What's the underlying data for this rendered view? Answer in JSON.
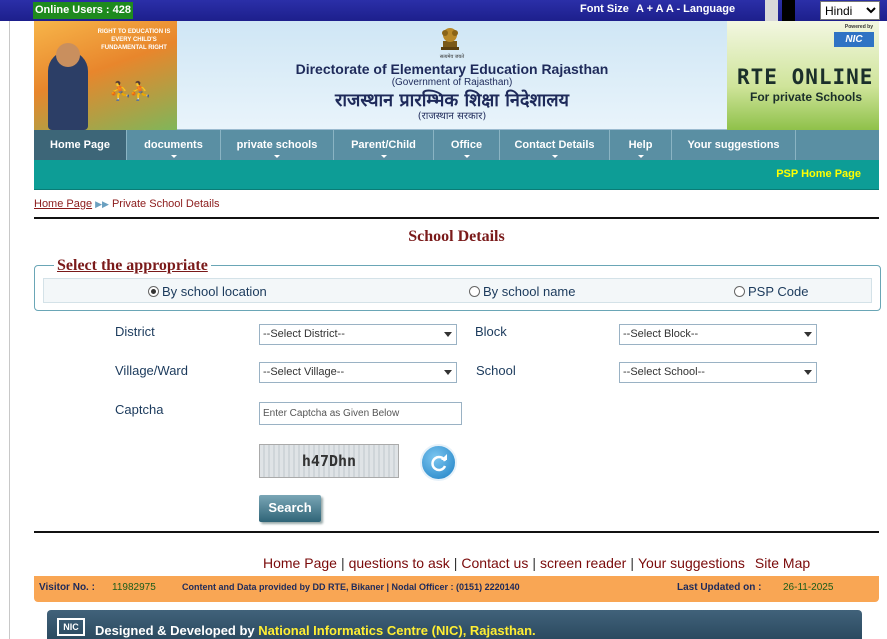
{
  "topbar": {
    "online_users": "Online Users : 428",
    "font_size_label": "Font Size",
    "font_controls": "A + A A - Language",
    "language_selected": "Hindi"
  },
  "banner": {
    "emblem_caption": "सत्यमेव जयते",
    "slogan": "RIGHT TO EDUCATION IS EVERY CHILD'S FUNDAMENTAL RIGHT",
    "title_en": "Directorate of Elementary Education Rajasthan",
    "subtitle_en": "(Government of Rajasthan)",
    "title_hi": "राजस्थान प्रारम्भिक शिक्षा निदेशालय",
    "subtitle_hi": "(राजस्थान सरकार)",
    "powered_by": "Powered by",
    "nic_logo": "NIC",
    "rte_title": "RTE ONLINE",
    "rte_subtitle": "For private Schools"
  },
  "nav": {
    "items": [
      {
        "label": "Home Page"
      },
      {
        "label": "documents"
      },
      {
        "label": "private schools"
      },
      {
        "label": "Parent/Child"
      },
      {
        "label": "Office"
      },
      {
        "label": "Contact Details"
      },
      {
        "label": "Help"
      },
      {
        "label": "Your suggestions"
      }
    ],
    "psp_link": "PSP Home Page"
  },
  "breadcrumb": {
    "home": "Home Page",
    "current": "Private School Details"
  },
  "page_title": "School Details",
  "selector": {
    "legend": "Select the appropriate",
    "options": [
      {
        "label": "By school location",
        "selected": true
      },
      {
        "label": "By school name",
        "selected": false
      },
      {
        "label": "PSP Code",
        "selected": false
      }
    ]
  },
  "form": {
    "district_label": "District",
    "district_value": "--Select District--",
    "block_label": "Block",
    "block_value": "--Select Block--",
    "village_label": "Village/Ward",
    "village_value": "--Select Village--",
    "school_label": "School",
    "school_value": "--Select School--",
    "captcha_label": "Captcha",
    "captcha_placeholder": "Enter Captcha as Given Below",
    "captcha_text": "h47Dhn",
    "search_label": "Search"
  },
  "footer_links": [
    "Home Page",
    "questions to ask",
    "Contact us",
    "screen reader",
    "Your suggestions",
    "Site Map"
  ],
  "footer": {
    "visitor_label": "Visitor No. :",
    "visitor_number": "11982975",
    "content_credit": "Content and Data provided by DD RTE, Bikaner  | Nodal Officer : (0151) 2220140",
    "last_updated_label": "Last Updated on :",
    "last_updated_date": "26-11-2025",
    "dev_prefix": "Designed & Developed by",
    "dev_org": "National Informatics Centre (NIC), Rajasthan."
  }
}
